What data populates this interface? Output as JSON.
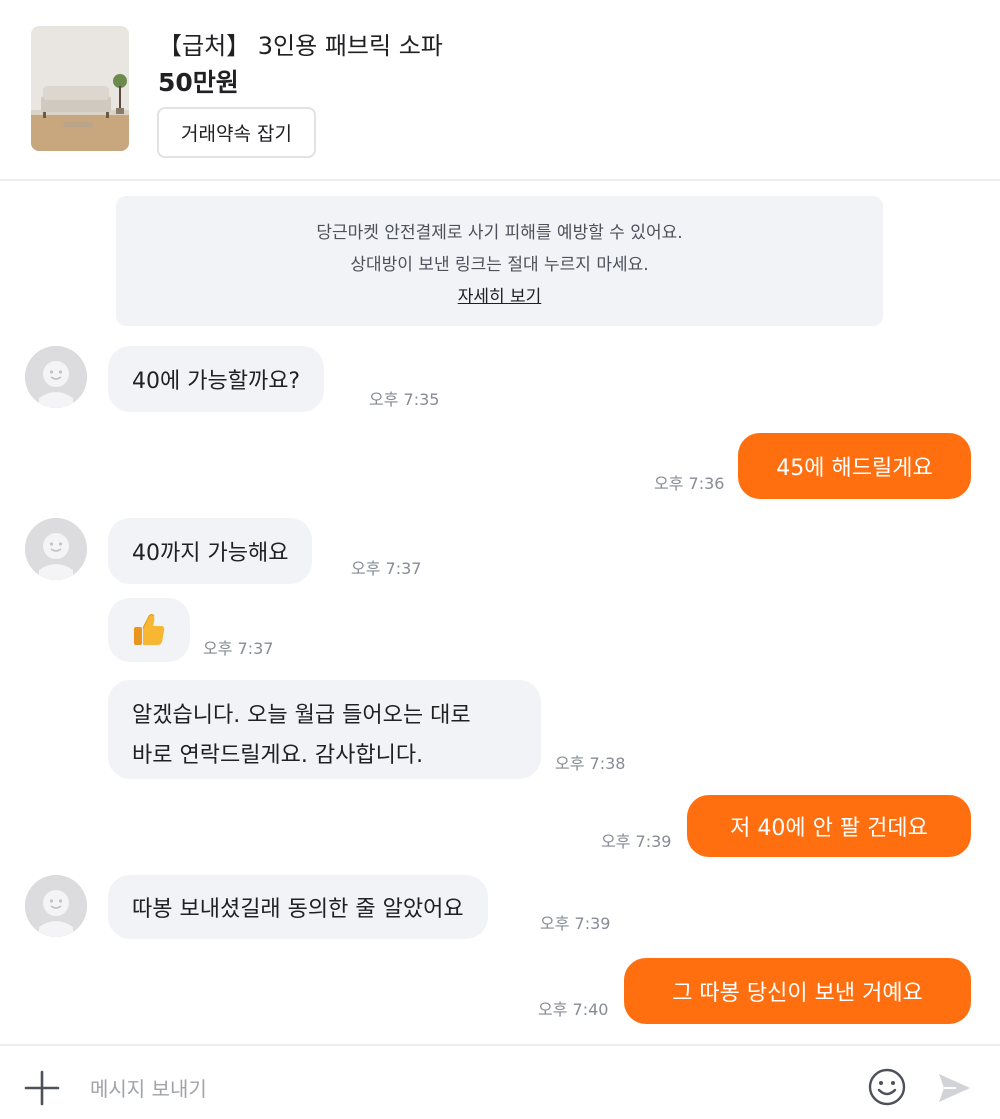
{
  "product": {
    "title": "【급처】 3인용 패브릭 소파",
    "price": "50만원",
    "appointment_button": "거래약속 잡기"
  },
  "notice": {
    "line1": "당근마켓 안전결제로 사기 피해를 예방할 수 있어요.",
    "line2": "상대방이 보낸 링크는 절대 누르지 마세요.",
    "link": "자세히 보기"
  },
  "messages": [
    {
      "from": "other",
      "text": "40에 가능할까요?",
      "time": "오후 7:35"
    },
    {
      "from": "me",
      "text": "45에 해드릴게요",
      "time": "오후 7:36"
    },
    {
      "from": "other",
      "text": "40까지 가능해요",
      "time": "오후 7:37"
    },
    {
      "from": "other",
      "text": "👍",
      "time": "오후 7:37",
      "icon": "thumbs-up-icon"
    },
    {
      "from": "other",
      "lines": [
        "알겠습니다. 오늘 월급 들어오는 대로",
        "바로 연락드릴게요. 감사합니다."
      ],
      "time": "오후 7:38"
    },
    {
      "from": "me",
      "text": "저 40에 안 팔 건데요",
      "time": "오후 7:39"
    },
    {
      "from": "other",
      "text": "따봉 보내셨길래 동의한 줄 알았어요",
      "time": "오후 7:39"
    },
    {
      "from": "me",
      "text": "그 따봉 당신이 보낸 거예요",
      "time": "오후 7:40"
    }
  ],
  "input": {
    "placeholder": "메시지 보내기"
  },
  "colors": {
    "accent": "#ff6f0f",
    "incoming_bubble": "#f2f3f6",
    "time_text": "#868b94"
  }
}
